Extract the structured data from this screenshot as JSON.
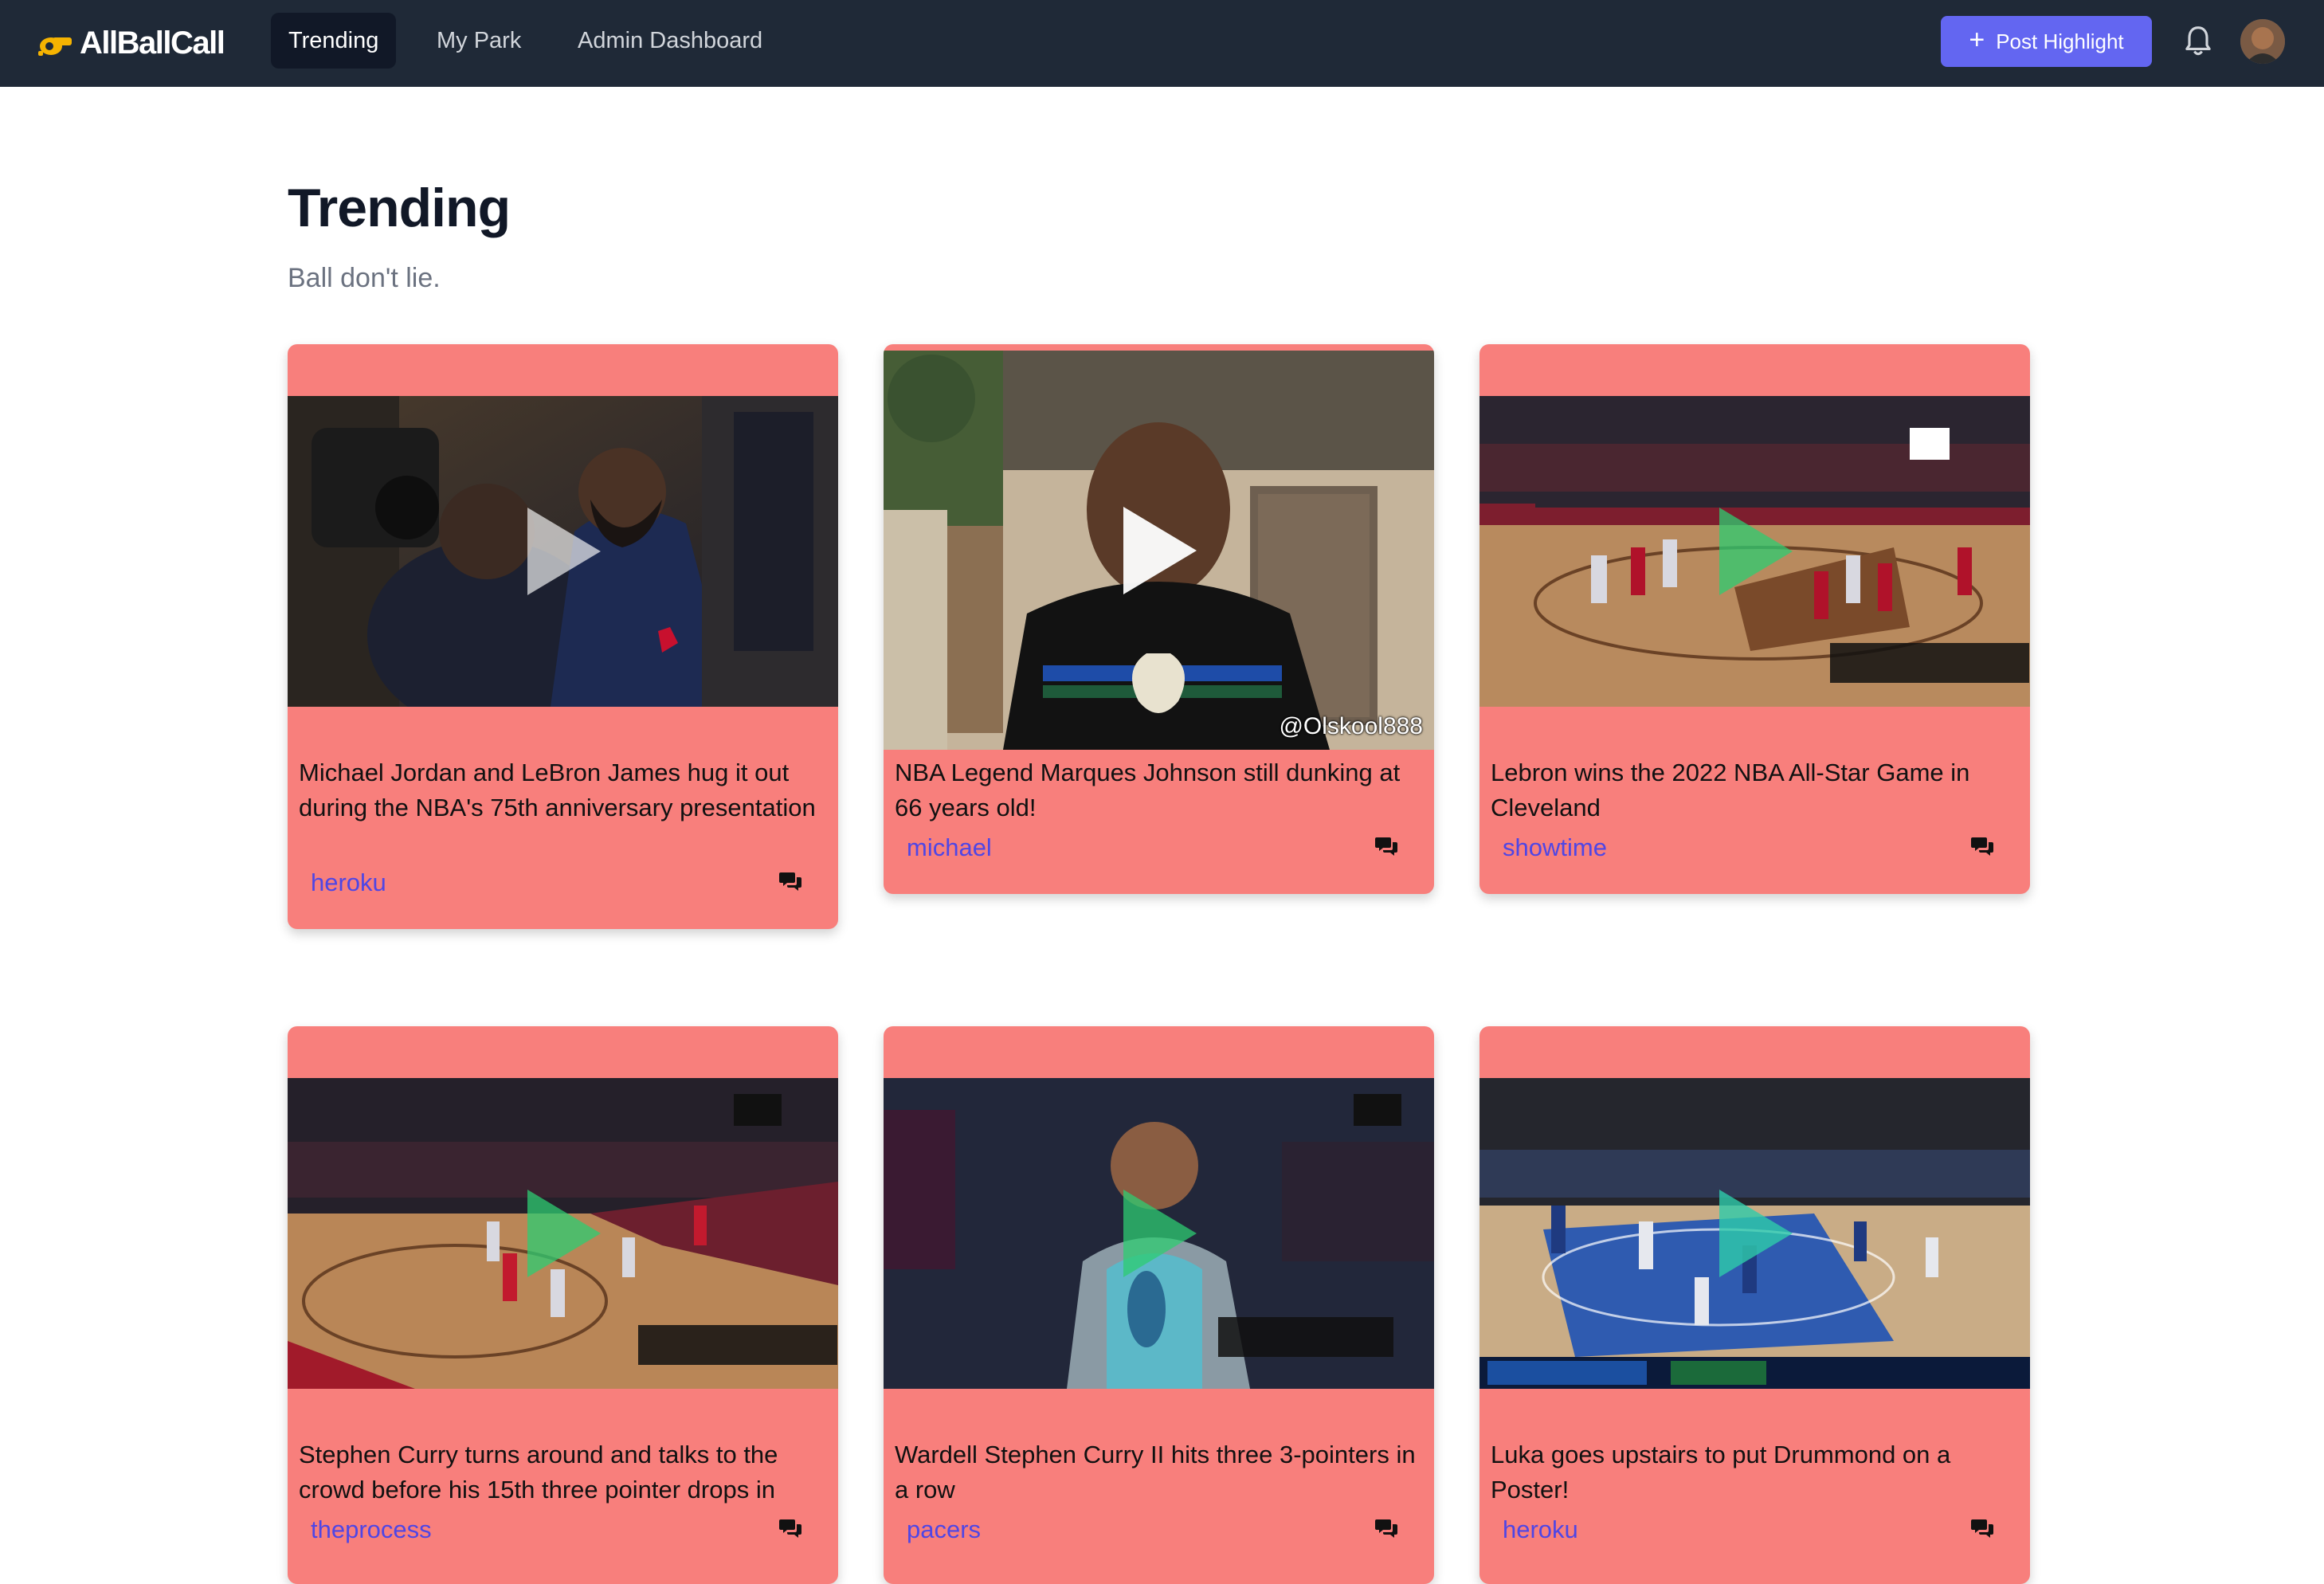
{
  "app": {
    "logo_text": "AllBallCall"
  },
  "nav": {
    "links": [
      {
        "label": "Trending"
      },
      {
        "label": "My Park"
      },
      {
        "label": "Admin Dashboard"
      }
    ],
    "post_button_label": "Post Highlight",
    "post_button_icon": "plus-icon",
    "bell_icon": "bell-icon",
    "avatar_icon": "user-avatar"
  },
  "page": {
    "title": "Trending",
    "subtitle": "Ball don't lie."
  },
  "cards": [
    {
      "title": "Michael Jordan and LeBron James hug it out during the NBA's 75th anniversary presentation",
      "user": "heroku",
      "play_icon": "play-icon-white"
    },
    {
      "title": "NBA Legend Marques Johnson still dunking at 66 years old!",
      "user": "michael",
      "watermark": "@Olskool888",
      "play_icon": "play-icon-white"
    },
    {
      "title": "Lebron wins the 2022 NBA All-Star Game in Cleveland",
      "user": "showtime",
      "play_icon": "play-icon-green"
    },
    {
      "title": "Stephen Curry turns around and talks to the crowd before his 15th three pointer drops in",
      "user": "theprocess",
      "play_icon": "play-icon-green"
    },
    {
      "title": "Wardell Stephen Curry II hits three 3-pointers in a row",
      "user": "pacers",
      "play_icon": "play-icon-green"
    },
    {
      "title": "Luka goes upstairs to put Drummond on a Poster!",
      "user": "heroku",
      "play_icon": "play-icon-green"
    }
  ],
  "colors": {
    "nav_bg": "#1f2937",
    "accent": "#6366f1",
    "card_bg": "#f87f7c",
    "username": "#4f46e5",
    "logo_whistle": "#f5b301"
  }
}
